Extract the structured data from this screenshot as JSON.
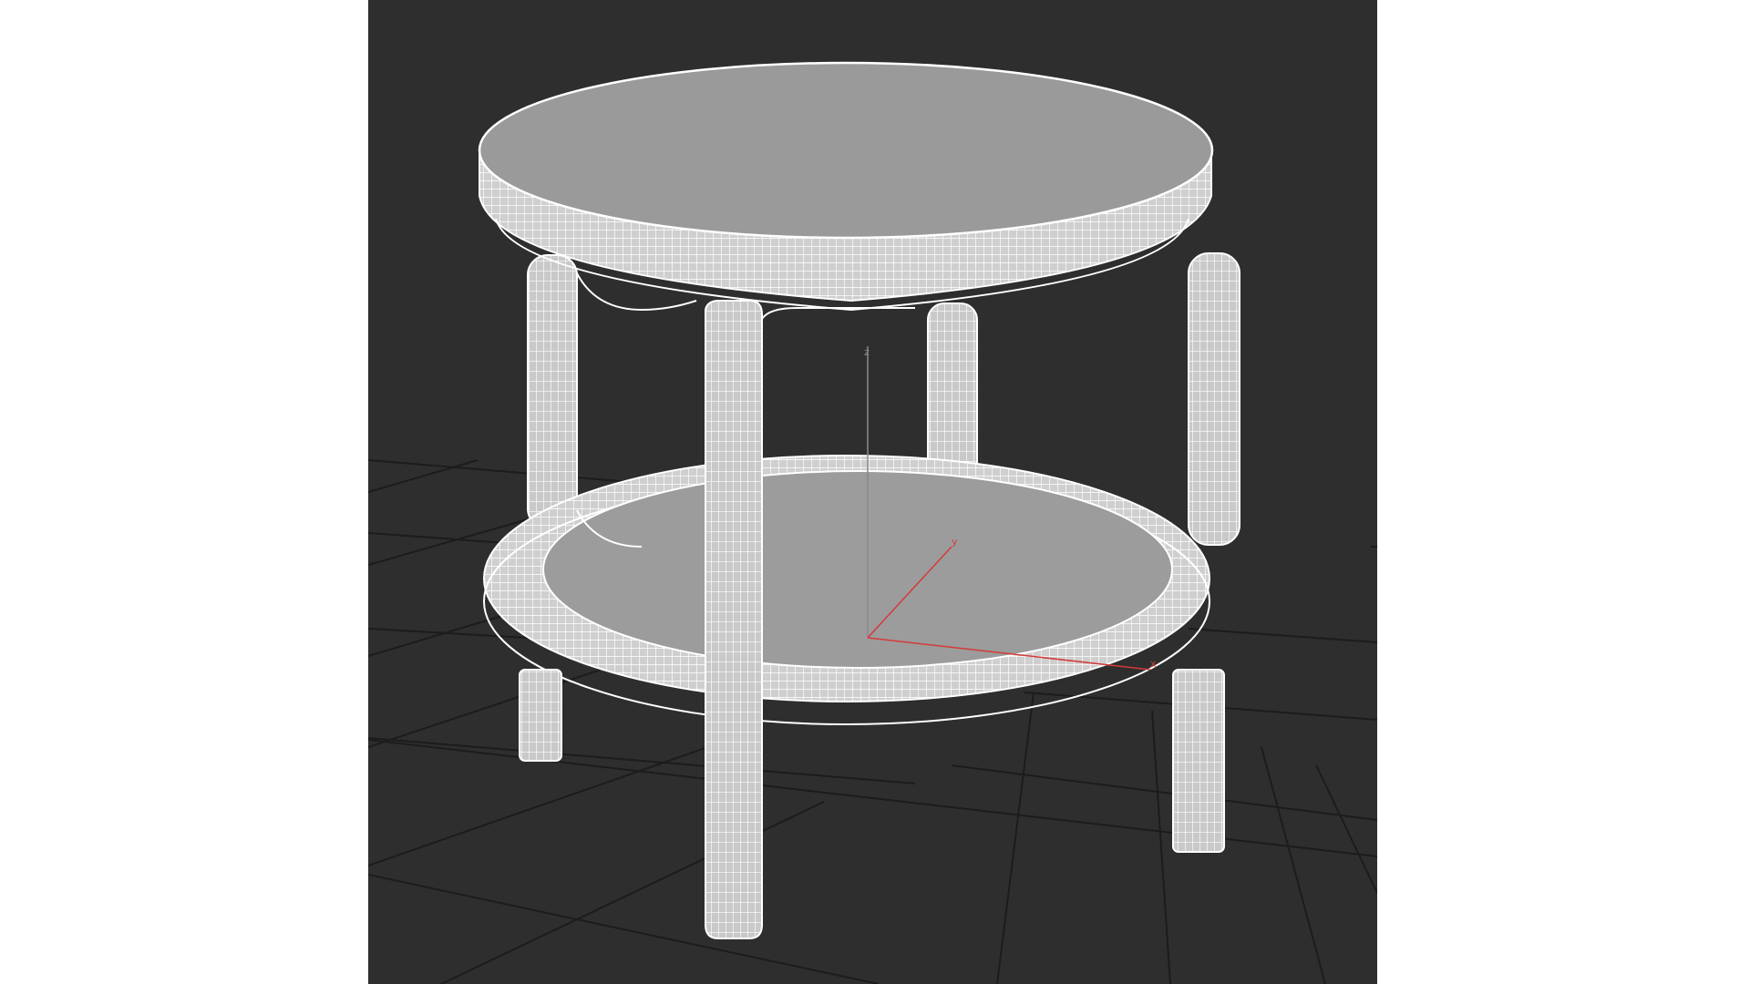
{
  "viewport": {
    "background": "#2e2e2e",
    "grid_color": "#1a1a1a",
    "mesh_fill": "#9c9c9c",
    "wire_color": "#ffffff",
    "axis_x_color": "#d43a3a",
    "axis_y_color": "#d43a3a",
    "axis_z_color": "#8a8a8a"
  },
  "axis_tripod": {
    "x_label": "x",
    "y_label": "y",
    "z_label": "z"
  },
  "model": {
    "icon": "wireframe-round-side-table"
  }
}
